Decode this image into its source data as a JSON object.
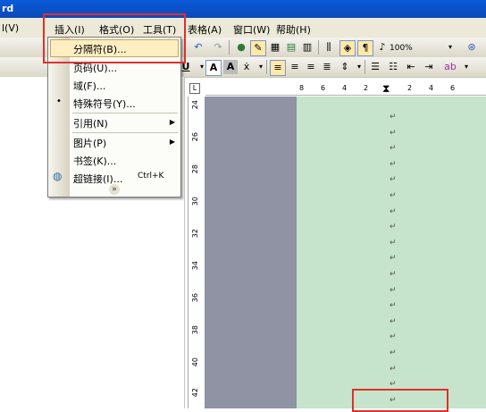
{
  "title_bar": {
    "text": "rd"
  },
  "menubar": {
    "items": [
      {
        "label": "l(V)"
      },
      {
        "label": "插入(I)"
      },
      {
        "label": "格式(O)"
      },
      {
        "label": "工具(T)"
      },
      {
        "label": "表格(A)"
      },
      {
        "label": "窗口(W)"
      },
      {
        "label": "帮助(H)"
      }
    ]
  },
  "toolbar": {
    "zoom": "100%"
  },
  "insert_menu": {
    "items": [
      {
        "label": "分隔符(B)...",
        "highlighted": true
      },
      {
        "label": "页码(U)..."
      },
      {
        "label": "域(F)..."
      },
      {
        "label": "特殊符号(Y)..."
      },
      {
        "label": "引用(N)",
        "submenu": true
      },
      {
        "label": "图片(P)",
        "submenu": true
      },
      {
        "label": "书签(K)..."
      },
      {
        "label": "超链接(I)...",
        "shortcut": "Ctrl+K"
      }
    ],
    "expand_icon": "double-chevron-down-icon"
  },
  "ruler": {
    "horizontal_ticks": [
      "8",
      "6",
      "4",
      "2",
      "2",
      "4",
      "6"
    ],
    "vertical_ticks": [
      "24",
      "26",
      "28",
      "30",
      "32",
      "34",
      "36",
      "38",
      "40",
      "42"
    ]
  },
  "document": {
    "paragraph_mark": "↵"
  },
  "colors": {
    "highlight_box": "#e0302a",
    "page_background": "#c5e4cb",
    "menu_highlight": "#ffeec2"
  }
}
